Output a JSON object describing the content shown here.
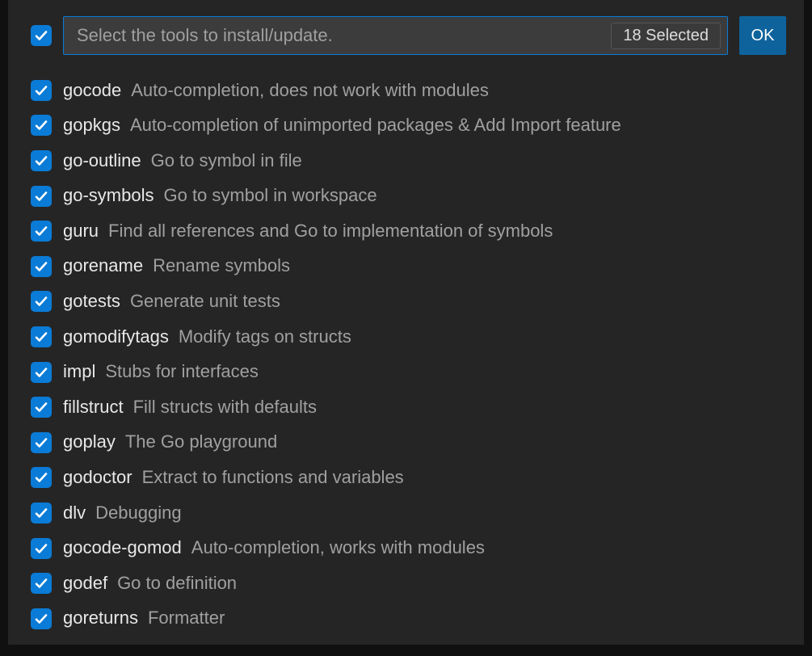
{
  "header": {
    "placeholder": "Select the tools to install/update.",
    "selected_badge": "18 Selected",
    "ok_label": "OK"
  },
  "items": [
    {
      "name": "gocode",
      "description": "Auto-completion, does not work with modules",
      "checked": true
    },
    {
      "name": "gopkgs",
      "description": "Auto-completion of unimported packages & Add Import feature",
      "checked": true
    },
    {
      "name": "go-outline",
      "description": "Go to symbol in file",
      "checked": true
    },
    {
      "name": "go-symbols",
      "description": "Go to symbol in workspace",
      "checked": true
    },
    {
      "name": "guru",
      "description": "Find all references and Go to implementation of symbols",
      "checked": true
    },
    {
      "name": "gorename",
      "description": "Rename symbols",
      "checked": true
    },
    {
      "name": "gotests",
      "description": "Generate unit tests",
      "checked": true
    },
    {
      "name": "gomodifytags",
      "description": "Modify tags on structs",
      "checked": true
    },
    {
      "name": "impl",
      "description": "Stubs for interfaces",
      "checked": true
    },
    {
      "name": "fillstruct",
      "description": "Fill structs with defaults",
      "checked": true
    },
    {
      "name": "goplay",
      "description": "The Go playground",
      "checked": true
    },
    {
      "name": "godoctor",
      "description": "Extract to functions and variables",
      "checked": true
    },
    {
      "name": "dlv",
      "description": "Debugging",
      "checked": true
    },
    {
      "name": "gocode-gomod",
      "description": "Auto-completion, works with modules",
      "checked": true
    },
    {
      "name": "godef",
      "description": "Go to definition",
      "checked": true
    },
    {
      "name": "goreturns",
      "description": "Formatter",
      "checked": true
    }
  ]
}
